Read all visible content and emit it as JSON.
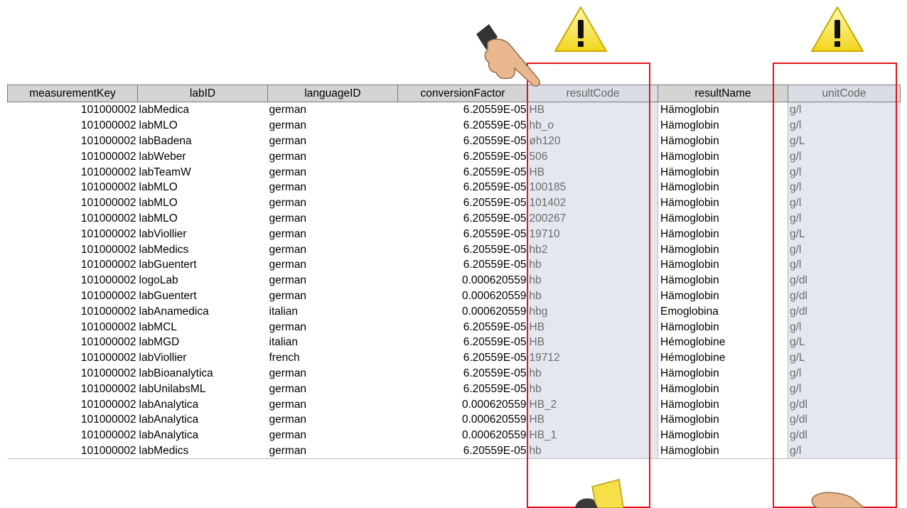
{
  "columns": [
    "measurementKey",
    "labID",
    "languageID",
    "conversionFactor",
    "resultCode",
    "resultName",
    "unitCode"
  ],
  "rows": [
    [
      "101000002",
      "labMedica",
      "german",
      "6.20559E-05",
      "HB",
      "Hämoglobin",
      "g/l"
    ],
    [
      "101000002",
      "labMLO",
      "german",
      "6.20559E-05",
      "hb_o",
      "Hämoglobin",
      "g/l"
    ],
    [
      "101000002",
      "labBadena",
      "german",
      "6.20559E-05",
      "øh120",
      "Hämoglobin",
      "g/L"
    ],
    [
      "101000002",
      "labWeber",
      "german",
      "6.20559E-05",
      "506",
      "Hämoglobin",
      "g/l"
    ],
    [
      "101000002",
      "labTeamW",
      "german",
      "6.20559E-05",
      "HB",
      "Hämoglobin",
      "g/l"
    ],
    [
      "101000002",
      "labMLO",
      "german",
      "6.20559E-05",
      "100185",
      "Hämoglobin",
      "g/l"
    ],
    [
      "101000002",
      "labMLO",
      "german",
      "6.20559E-05",
      "101402",
      "Hämoglobin",
      "g/l"
    ],
    [
      "101000002",
      "labMLO",
      "german",
      "6.20559E-05",
      "200267",
      "Hämoglobin",
      "g/l"
    ],
    [
      "101000002",
      "labViollier",
      "german",
      "6.20559E-05",
      "19710",
      "Hämoglobin",
      "g/L"
    ],
    [
      "101000002",
      "labMedics",
      "german",
      "6.20559E-05",
      "hb2",
      "Hämoglobin",
      "g/l"
    ],
    [
      "101000002",
      "labGuentert",
      "german",
      "6.20559E-05",
      "hb",
      "Hämoglobin",
      "g/l"
    ],
    [
      "101000002",
      "logoLab",
      "german",
      "0.000620559",
      "hb",
      "Hämoglobin",
      "g/dl"
    ],
    [
      "101000002",
      "labGuentert",
      "german",
      "0.000620559",
      "hb",
      "Hämoglobin",
      "g/dl"
    ],
    [
      "101000002",
      "labAnamedica",
      "italian",
      "0.000620559",
      "hbg",
      "Emoglobina",
      "g/dl"
    ],
    [
      "101000002",
      "labMCL",
      "german",
      "6.20559E-05",
      "HB",
      "Hämoglobin",
      "g/l"
    ],
    [
      "101000002",
      "labMGD",
      "italian",
      "6.20559E-05",
      "HB",
      "Hémoglobine",
      "g/L"
    ],
    [
      "101000002",
      "labViollier",
      "french",
      "6.20559E-05",
      "19712",
      "Hémoglobine",
      "g/L"
    ],
    [
      "101000002",
      "labBioanalytica",
      "german",
      "6.20559E-05",
      "hb",
      "Hämoglobin",
      "g/l"
    ],
    [
      "101000002",
      "labUnilabsML",
      "german",
      "6.20559E-05",
      "hb",
      "Hämoglobin",
      "g/l"
    ],
    [
      "101000002",
      "labAnalytica",
      "german",
      "0.000620559",
      "HB_2",
      "Hämoglobin",
      "g/dl"
    ],
    [
      "101000002",
      "labAnalytica",
      "german",
      "0.000620559",
      "HB",
      "Hämoglobin",
      "g/dl"
    ],
    [
      "101000002",
      "labAnalytica",
      "german",
      "0.000620559",
      "HB_1",
      "Hämoglobin",
      "g/dl"
    ],
    [
      "101000002",
      "labMedics",
      "german",
      "6.20559E-05",
      "hb",
      "Hämoglobin",
      "g/l"
    ]
  ],
  "highlighted_columns": [
    "resultCode",
    "unitCode"
  ],
  "colors": {
    "highlight_border": "#e3141a",
    "warning_fill": "#f7ea3c",
    "header_bg": "#d4d4d4"
  },
  "icons": [
    "warning-icon",
    "pointing-hand-icon"
  ]
}
